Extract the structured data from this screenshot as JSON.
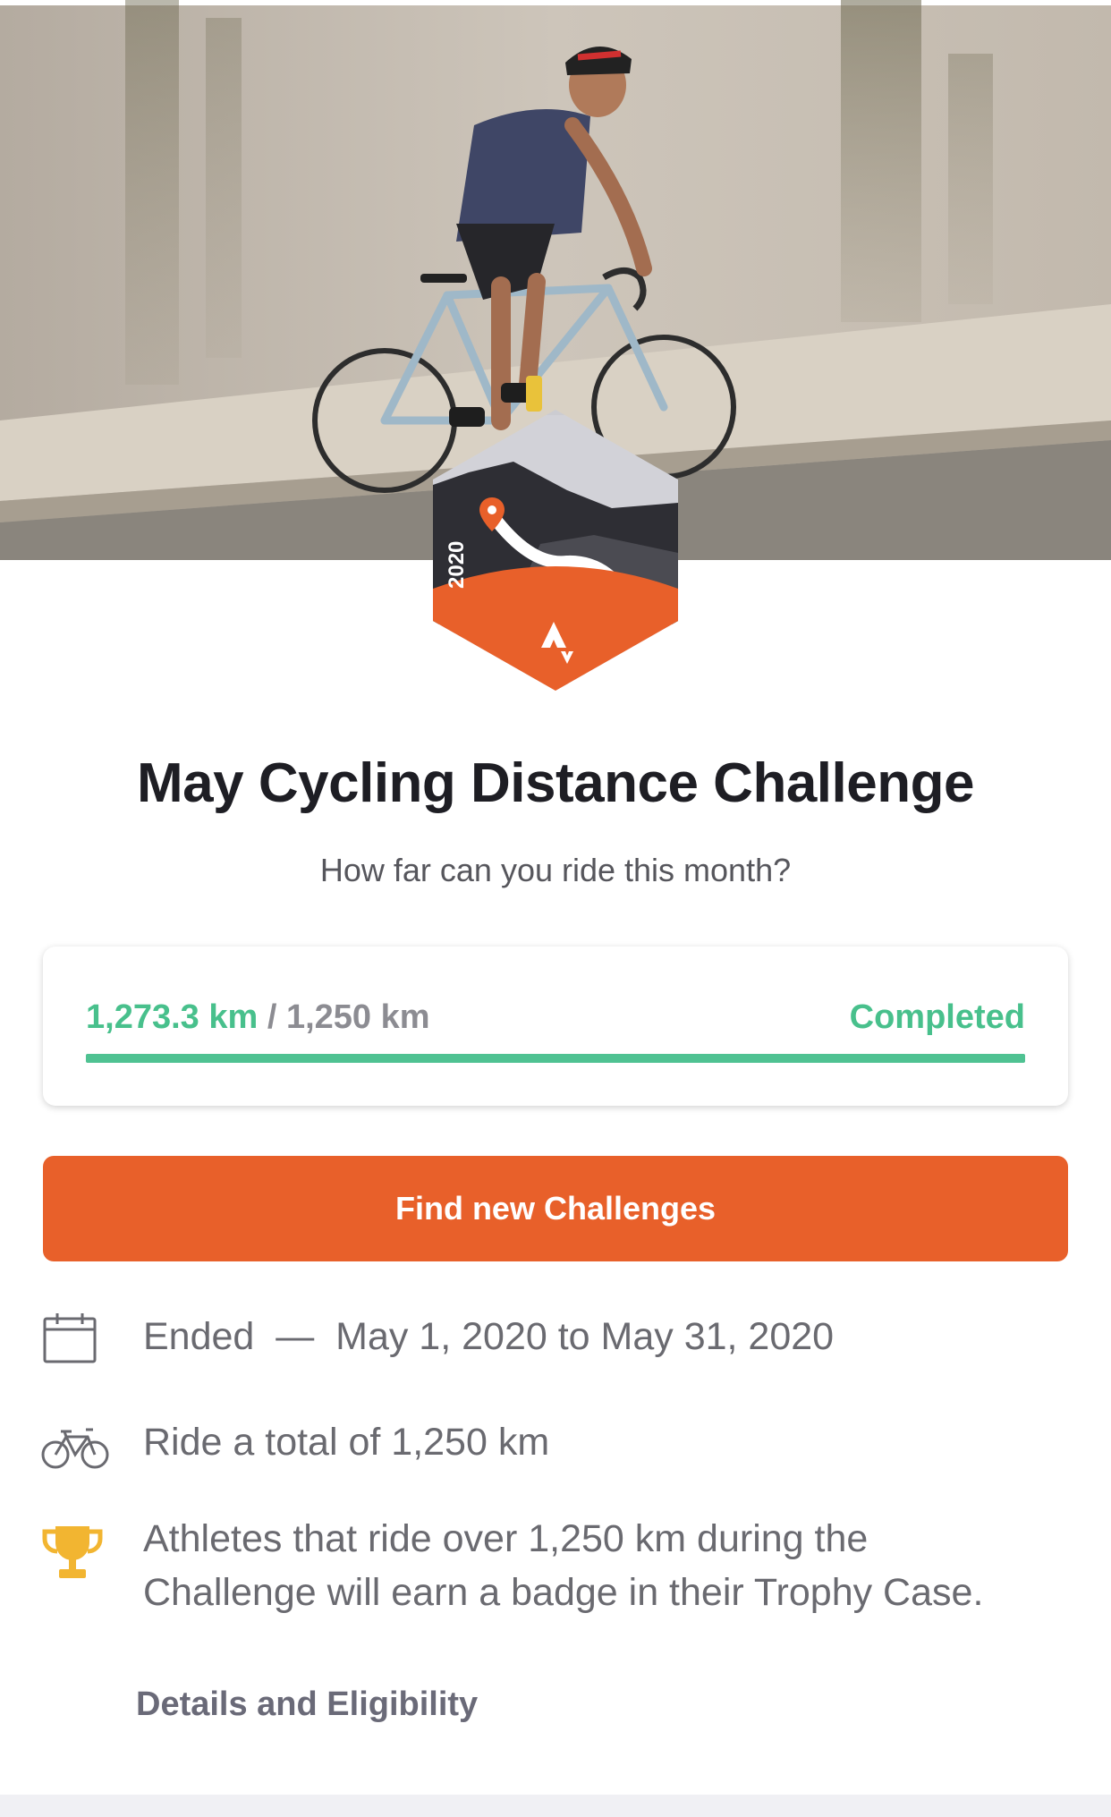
{
  "hero": {
    "image_subject": "cyclist riding a road bike past a concrete wall"
  },
  "badge": {
    "year": "2020",
    "colors": {
      "top": "#d2d2d8",
      "mountain": "#2e2e34",
      "road": "#4b4b52",
      "bottom": "#e8602a",
      "pin": "#e8602a"
    },
    "logo_icon": "strava-logo-icon"
  },
  "challenge": {
    "title": "May Cycling Distance Challenge",
    "subtitle": "How far can you ride this month?"
  },
  "progress": {
    "current": "1,273.3 km",
    "separator": "/",
    "goal": "1,250 km",
    "status": "Completed",
    "fraction": 1.0,
    "color": "#4fc292"
  },
  "cta": {
    "label": "Find new Challenges",
    "color": "#e8602a"
  },
  "info": {
    "dates_label": "Ended  —  May 1, 2020 to May 31, 2020",
    "dates_icon": "calendar-icon",
    "goal_label": "Ride a total of 1,250 km",
    "goal_icon": "bicycle-icon",
    "reward_label": "Athletes that ride over 1,250 km during the Challenge will earn a badge in their Trophy Case.",
    "reward_icon": "trophy-icon",
    "trophy_color": "#f2b531"
  },
  "details_link": "Details and Eligibility"
}
